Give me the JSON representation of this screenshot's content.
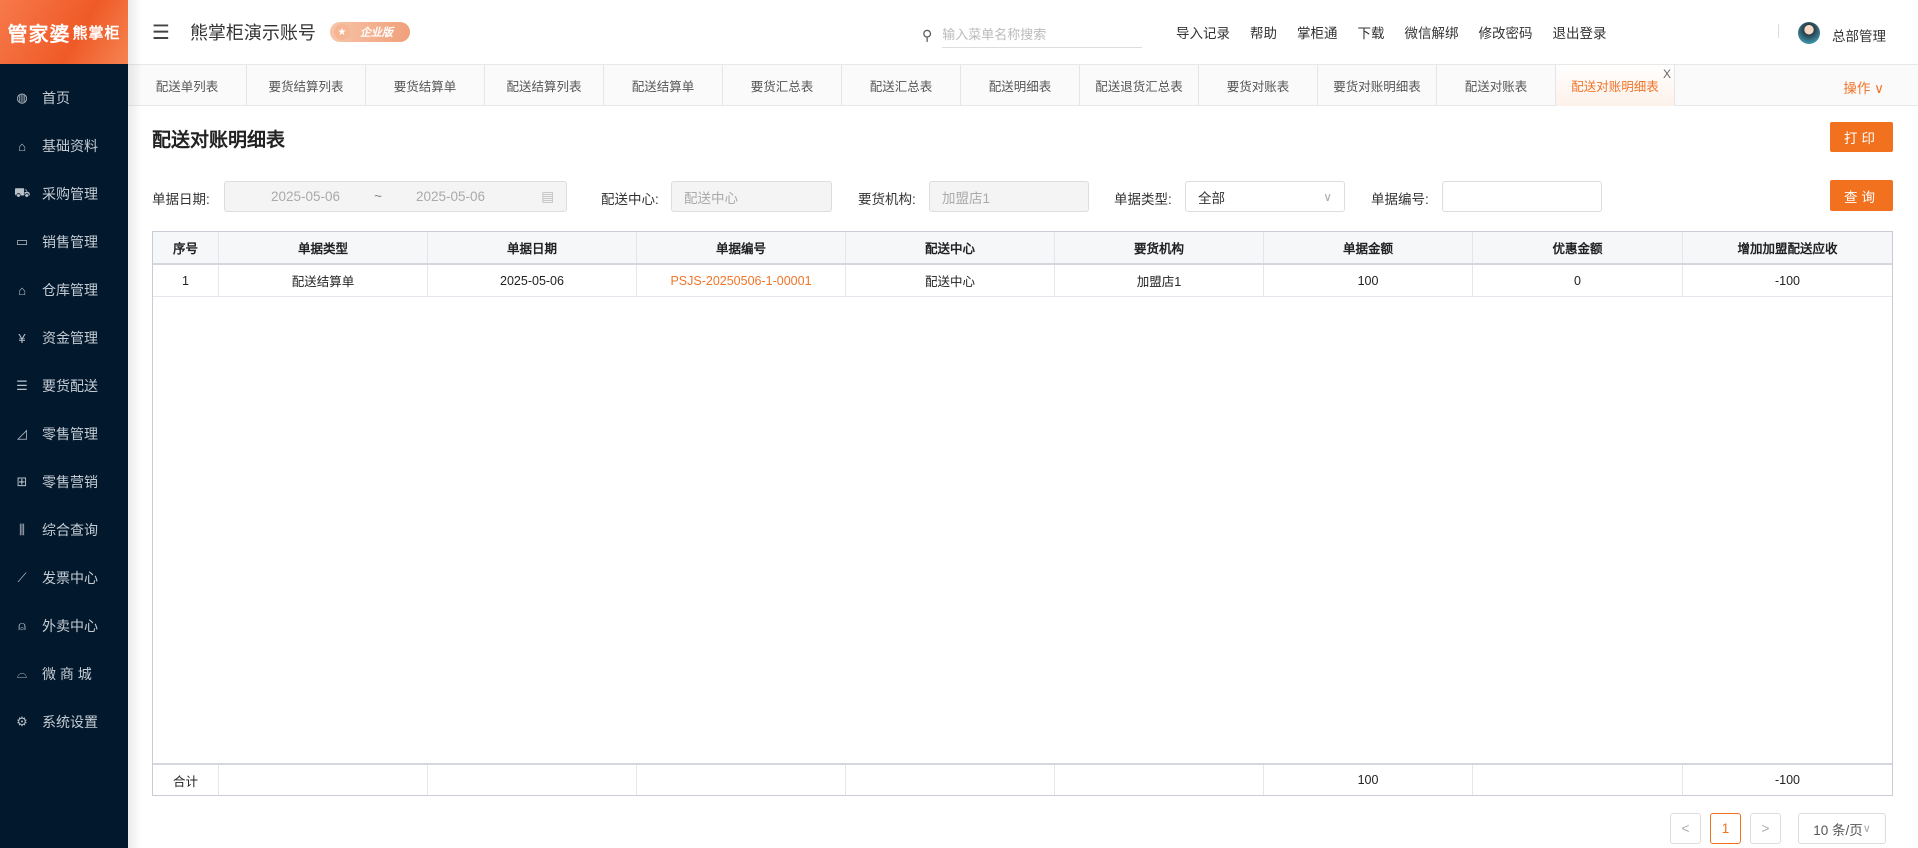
{
  "logo": {
    "text": "管家婆",
    "sub": "熊掌柜"
  },
  "sidebar": {
    "items": [
      {
        "label": "首页",
        "icon": "globe-icon",
        "glyph": "◍"
      },
      {
        "label": "基础资料",
        "icon": "home-icon",
        "glyph": "⌂"
      },
      {
        "label": "采购管理",
        "icon": "cart-icon",
        "glyph": "⛟"
      },
      {
        "label": "销售管理",
        "icon": "calendar-icon",
        "glyph": "▭"
      },
      {
        "label": "仓库管理",
        "icon": "bank-icon",
        "glyph": "⌂"
      },
      {
        "label": "资金管理",
        "icon": "money-icon",
        "glyph": "¥"
      },
      {
        "label": "要货配送",
        "icon": "list-icon",
        "glyph": "☰"
      },
      {
        "label": "零售管理",
        "icon": "area-chart-icon",
        "glyph": "◿"
      },
      {
        "label": "零售营销",
        "icon": "gift-icon",
        "glyph": "⊞"
      },
      {
        "label": "综合查询",
        "icon": "bar-chart-icon",
        "glyph": "⫼"
      },
      {
        "label": "发票中心",
        "icon": "line-chart-icon",
        "glyph": "⟋"
      },
      {
        "label": "外卖中心",
        "icon": "alarm-icon",
        "glyph": "⍝"
      },
      {
        "label": "微 商 城",
        "icon": "bag-icon",
        "glyph": "⌓"
      },
      {
        "label": "系统设置",
        "icon": "gear-icon",
        "glyph": "⚙"
      }
    ]
  },
  "header": {
    "account": "熊掌柜演示账号",
    "edition": "企业版",
    "search_placeholder": "输入菜单名称搜索",
    "links": [
      "导入记录",
      "帮助",
      "掌柜通",
      "下载",
      "微信解绑",
      "修改密码",
      "退出登录"
    ],
    "user": "总部管理"
  },
  "tabs": [
    "配送单列表",
    "要货结算列表",
    "要货结算单",
    "配送结算列表",
    "配送结算单",
    "要货汇总表",
    "配送汇总表",
    "配送明细表",
    "配送退货汇总表",
    "要货对账表",
    "要货对账明细表",
    "配送对账表",
    "配送对账明细表"
  ],
  "tabs_close": "X",
  "operations": "操作 ∨",
  "page": {
    "title": "配送对账明细表",
    "print": "打印",
    "query": "查询"
  },
  "filters": {
    "date_label": "单据日期:",
    "date_from": "2025-05-06",
    "date_sep": "~",
    "date_to": "2025-05-06",
    "center_label": "配送中心:",
    "center_placeholder": "配送中心",
    "org_label": "要货机构:",
    "org_value": "加盟店1",
    "type_label": "单据类型:",
    "type_value": "全部",
    "no_label": "单据编号:",
    "no_value": ""
  },
  "table": {
    "columns": [
      "序号",
      "单据类型",
      "单据日期",
      "单据编号",
      "配送中心",
      "要货机构",
      "单据金额",
      "优惠金额",
      "增加加盟配送应收"
    ],
    "rows": [
      [
        "1",
        "配送结算单",
        "2025-05-06",
        "PSJS-20250506-1-00001",
        "配送中心",
        "加盟店1",
        "100",
        "0",
        "-100"
      ]
    ],
    "footer": [
      "合计",
      "",
      "",
      "",
      "",
      "",
      "100",
      "",
      "-100"
    ]
  },
  "pagination": {
    "prev": "<",
    "current": "1",
    "next": ">",
    "page_size": "10 条/页"
  },
  "colors": {
    "accent": "#f2711f",
    "sidebar": "#01182d"
  }
}
